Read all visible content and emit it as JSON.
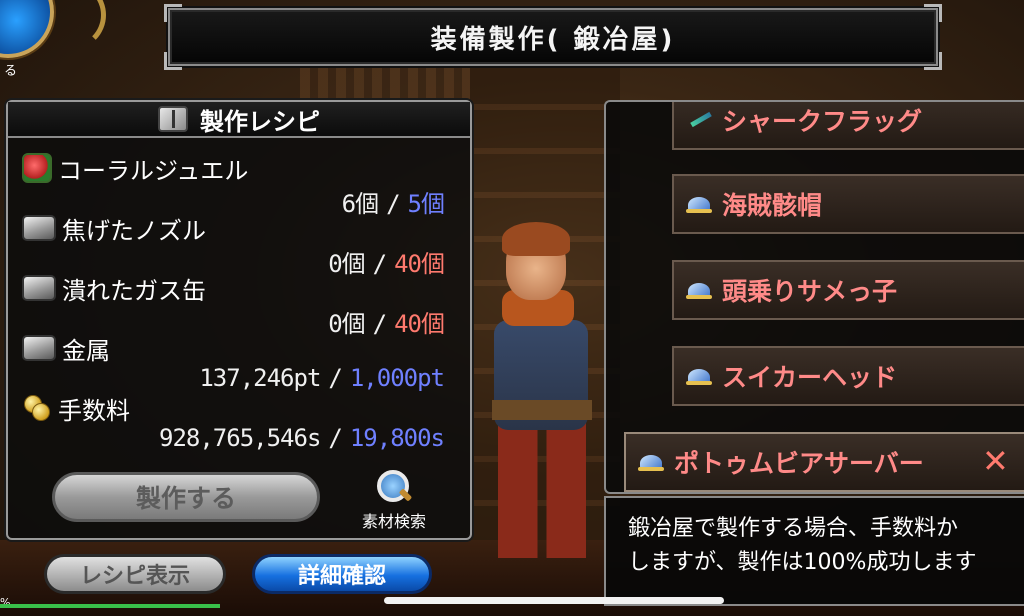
{
  "title": "装備製作( 鍛冶屋)",
  "corner_button": {
    "label": "る"
  },
  "recipe": {
    "header": "製作レシピ",
    "materials": [
      {
        "name": "コーラルジュエル",
        "have": "6個",
        "need": "5個",
        "status": "ok",
        "icon": "coral-jewel-icon"
      },
      {
        "name": "焦げたノズル",
        "have": "0個",
        "need": "40個",
        "status": "insufficient",
        "icon": "metal-ingot-icon"
      },
      {
        "name": "潰れたガス缶",
        "have": "0個",
        "need": "40個",
        "status": "insufficient",
        "icon": "metal-ingot-icon"
      },
      {
        "name": "金属",
        "have": "137,246pt",
        "need": "1,000pt",
        "status": "ok",
        "icon": "metal-ingot-icon"
      },
      {
        "name": "手数料",
        "have": "928,765,546s",
        "need": "19,800s",
        "status": "ok",
        "icon": "coin-icon"
      }
    ],
    "separator": "/",
    "craft_button": "製作する",
    "search_label": "素材検索"
  },
  "bottom_buttons": {
    "recipe_display": "レシピ表示",
    "details": "詳細確認"
  },
  "items": [
    {
      "name": "シャークフラッグ",
      "icon": "sword-icon"
    },
    {
      "name": "海賊骸帽",
      "icon": "hat-icon"
    },
    {
      "name": "頭乗りサメっ子",
      "icon": "hat-icon"
    },
    {
      "name": "スイカーヘッド",
      "icon": "hat-icon"
    },
    {
      "name": "ポトゥムビアサーバー",
      "icon": "hat-icon",
      "selected": true
    }
  ],
  "close_mark": "✕",
  "description": {
    "line1": "鍛冶屋で製作する場合、手数料か",
    "line2": "しますが、製作は100%成功します"
  },
  "status_pct": "%",
  "colors": {
    "ok": "#6f80ff",
    "insufficient": "#ff7a6e",
    "item_text": "#ff8a88"
  }
}
